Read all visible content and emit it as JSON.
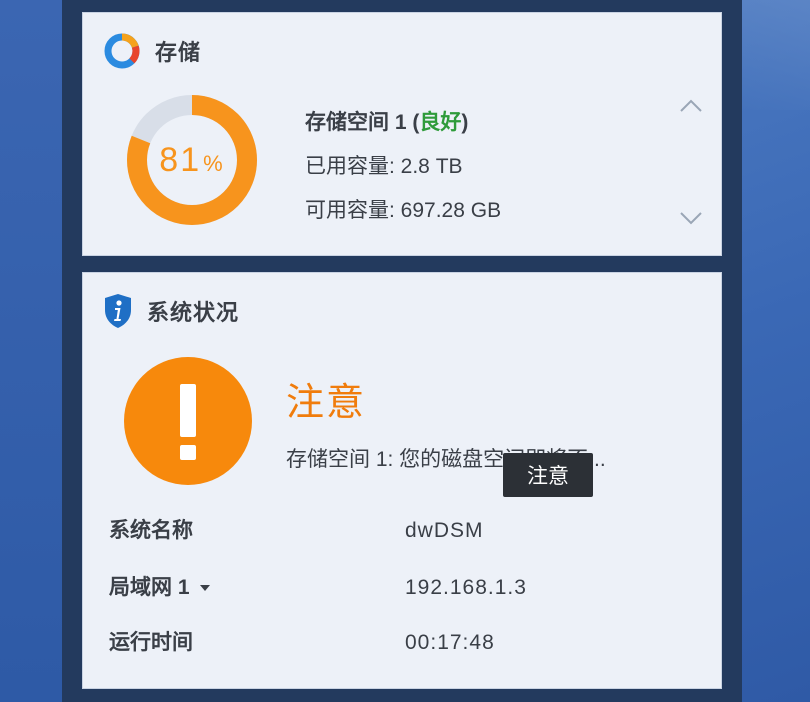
{
  "storage": {
    "title": "存储",
    "usage_percent": 81,
    "percent_number": "81",
    "percent_sign": "%",
    "volume_name": "存储空间 1",
    "status_open": " (",
    "status": "良好",
    "status_close": ")",
    "used_label": "已用容量: ",
    "used_value": "2.8 TB",
    "free_label": "可用容量: ",
    "free_value": "697.28 GB",
    "colors": {
      "used": "#f7941d",
      "free": "#d8dee8",
      "status_good": "#2e9b3a"
    }
  },
  "system_status": {
    "title": "系统状况",
    "alert_title": "注意",
    "alert_message": "存储空间 1:  您的磁盘空间即将不...",
    "tooltip": "注意",
    "rows": [
      {
        "label": "系统名称",
        "value": "dwDSM"
      },
      {
        "label": "局域网 1",
        "value": "192.168.1.3"
      },
      {
        "label": "运行时间",
        "value": "00:17:48"
      }
    ],
    "colors": {
      "alert": "#f7890c",
      "alert_text": "#f07c0c"
    }
  },
  "icons": {
    "storage": "storage-ring-icon",
    "status": "info-shield-icon",
    "alert": "exclamation-icon",
    "collapse": "chevron-up-icon",
    "expand": "chevron-down-icon",
    "lan_dropdown": "caret-down-icon"
  }
}
